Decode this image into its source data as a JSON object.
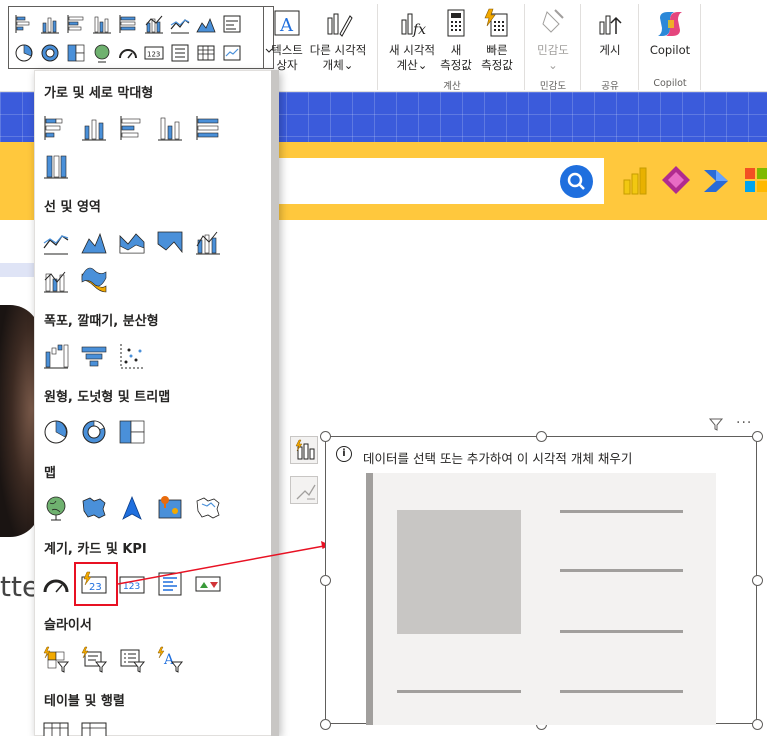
{
  "ribbon": {
    "text_box": {
      "line1": "텍스트",
      "line2": "상자"
    },
    "more_visuals": {
      "line1": "다른 시각적",
      "line2": "개체⌄"
    },
    "new_visual_calc": {
      "line1": "새 시각적",
      "line2": "계산⌄"
    },
    "new_measure": {
      "line1": "새",
      "line2": "측정값"
    },
    "quick_measure": {
      "line1": "빠른",
      "line2": "측정값"
    },
    "sensitivity": {
      "line1": "민감도",
      "line2": "⌄"
    },
    "publish": {
      "line1": "게시"
    },
    "copilot": {
      "line1": "Copilot"
    },
    "groups": {
      "calc": "계산",
      "sensitivity": "민감도",
      "share": "공유",
      "copilot": "Copilot"
    }
  },
  "panel": {
    "sections": [
      {
        "title": "가로 및 세로 막대형"
      },
      {
        "title": "선 및 영역"
      },
      {
        "title": "폭포, 깔때기, 분산형"
      },
      {
        "title": "원형, 도넛형 및 트리맵"
      },
      {
        "title": "맵"
      },
      {
        "title": "계기, 카드 및 KPI"
      },
      {
        "title": "슬라이서"
      },
      {
        "title": "테이블 및 행렬"
      }
    ]
  },
  "canvas": {
    "placeholder": "데이터를 선택 또는 추가하여 이 시각적 개체 채우기",
    "bg_text": "tte",
    "more": "···"
  },
  "colors": {
    "accent": "#1f6fde",
    "highlight": "#e81123",
    "brand_yellow": "#ffc83d",
    "brand_blue": "#3b5bdb"
  }
}
